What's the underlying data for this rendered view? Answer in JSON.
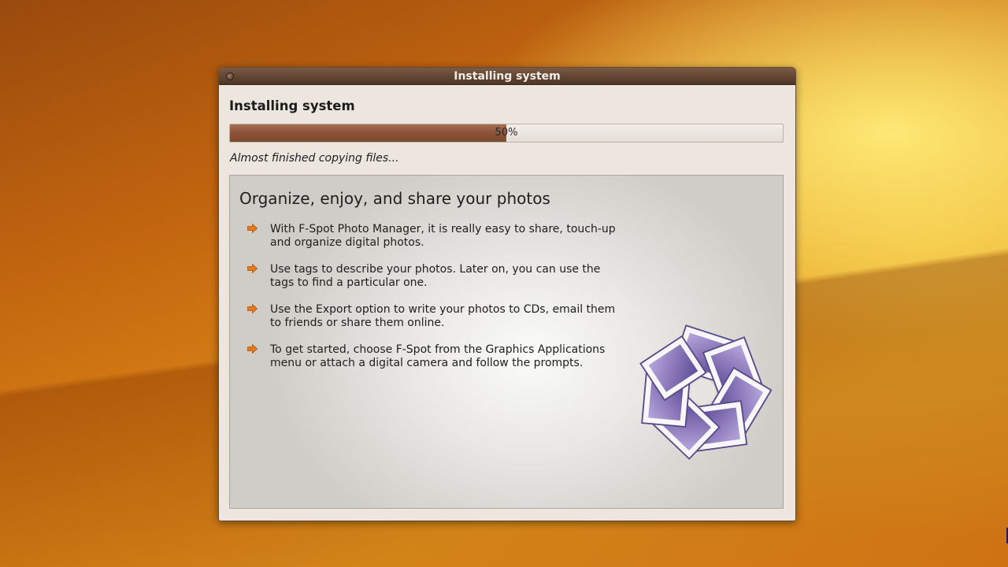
{
  "window": {
    "title": "Installing system"
  },
  "main": {
    "heading": "Installing system",
    "progress": {
      "percent": 50,
      "label": "50%"
    },
    "status": "Almost finished copying files..."
  },
  "slide": {
    "title": "Organize, enjoy, and share your photos",
    "bullets": [
      {
        "icon": "orange-arrow-icon",
        "text_line1": "With F-Spot Photo Manager, it is really easy to share, touch-up",
        "text_line2": "and organize digital photos."
      },
      {
        "icon": "orange-arrow-icon",
        "text_line1": "Use tags to describe your photos. Later on, you can use the",
        "text_line2": "tags to find a particular one."
      },
      {
        "icon": "orange-arrow-icon",
        "text_line1": "Use the Export option to write your photos to CDs, email them",
        "text_line2": "to friends or share them online."
      },
      {
        "icon": "orange-arrow-icon",
        "text_line1": "To get started, choose F-Spot from the Graphics Applications",
        "text_line2": "menu or attach a digital camera and follow the prompts."
      }
    ],
    "logo_icon": "f-spot-logo-icon"
  },
  "colors": {
    "titlebar": "#5e4230",
    "progress_fill": "#8c5238",
    "bullet_arrow": "#e07a1e",
    "logo_purple": "#7a66b0"
  }
}
